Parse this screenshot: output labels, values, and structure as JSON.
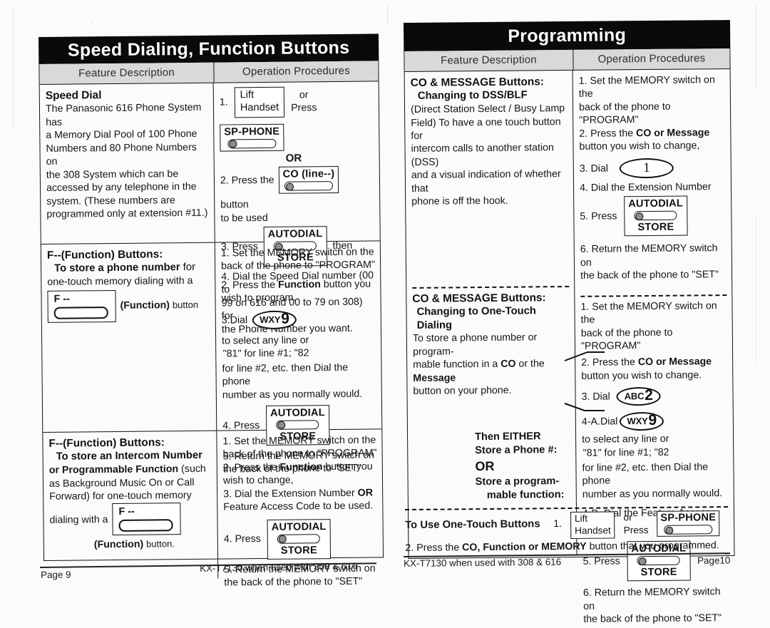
{
  "document": {
    "type": "scanned-manual-spread",
    "model_note": "KX-T7130 when used with 308 & 616"
  },
  "left_page": {
    "banner_title": "Speed Dialing, Function Buttons",
    "columns": {
      "feature": "Feature Description",
      "operation": "Operation Procedures"
    },
    "rows": [
      {
        "feature": {
          "title": "Speed Dial",
          "body": [
            "The Panasonic 616 Phone System has",
            "a Memory Dial Pool of 100 Phone",
            "Numbers and 80 Phone Numbers on",
            "the 308 System which can be",
            "accessed by any telephone in the",
            "system.  (These numbers are",
            "programmed only at extension #11.)"
          ]
        },
        "operation": {
          "step1_num": "1.",
          "step1_box1_line1": "Lift",
          "step1_box1_line2": "Handset",
          "step1_or": "or",
          "step1_press": "Press",
          "step1_sp_phone": "SP-PHONE",
          "step1_or_big": "OR",
          "step2_text": "2. Press the",
          "step2_button": "CO (line--)",
          "step2_after_line1": "button",
          "step2_after_line2": "to be used",
          "step3_text": "3. Press",
          "step3_button_top": "AUTODIAL",
          "step3_button_bottom": "STORE",
          "step3_after": "then",
          "step4_lines": [
            "4. Dial the Speed Dial number (00 to",
            "99 on 616 and 00 to 79 on 308) for",
            "the Phone Number you want."
          ]
        }
      },
      {
        "feature": {
          "title": "F--(Function) Buttons:",
          "subtitle_bold": "To store a phone number",
          "subtitle_rest": "for",
          "body_line": "one-touch memory dialing with a",
          "key_label": "F --",
          "after_key_bold": "(Function)",
          "after_key_rest": "button"
        },
        "operation": {
          "step1_lines": [
            "1. Set the MEMORY switch on the",
            "back of the phone to \"PROGRAM\""
          ],
          "step2_pre": "2. Press the",
          "step2_bold": "Function",
          "step2_post": "button you",
          "step2_line2": "wish to program.",
          "step3_pre": "3.Dial",
          "step3_key_small": "WXY",
          "step3_key_big": "9",
          "step3_post_line1": "to select any line or",
          "step3_post_line2": "\"81\" for line #1; \"82",
          "step3_cont": [
            "for line #2, etc. then Dial the phone",
            "number as you normally would."
          ],
          "step4_text": "4. Press",
          "step4_button_top": "AUTODIAL",
          "step4_button_bottom": "STORE",
          "step5_lines": [
            "5. Return the MEMORY switch on",
            "the back of the phone to \"SET\""
          ]
        }
      },
      {
        "feature": {
          "title": "F--(Function) Buttons:",
          "subtitle_bold": "To store an Intercom Number",
          "line2_bold": "or Programmable Function",
          "line2_rest": "(such",
          "body": [
            "as Background Music On or Call",
            "Forward) for one-touch memory"
          ],
          "body_last": "dialing with a",
          "key_label": "F --",
          "caption_bold": "(Function)",
          "caption_rest": "button."
        },
        "operation": {
          "step1_lines": [
            "1. Set the MEMORY switch on the",
            "back of the phone to \"PROGRAM\""
          ],
          "step2_pre": "2. Press the",
          "step2_bold": "Function",
          "step2_post": "button you",
          "step2_line2": "wish to change,",
          "step3_pre": "3. Dial the Extension Number",
          "step3_bold": "OR",
          "step3_line2": "Feature Access Code to be used.",
          "step4_text": "4. Press",
          "step4_button_top": "AUTODIAL",
          "step4_button_bottom": "STORE",
          "step5_lines": [
            "5. Return the MEMORY switch on",
            "the back of the phone to \"SET\""
          ]
        }
      }
    ],
    "footer": {
      "page_label": "Page 9",
      "model_note": "KX-T7130 when used with 308 & 616"
    }
  },
  "right_page": {
    "banner_title": "Programming",
    "columns": {
      "feature": "Feature Description",
      "operation": "Operation Procedures"
    },
    "sections": [
      {
        "feature": {
          "title": "CO & MESSAGE Buttons:",
          "subtitle": "Changing to DSS/BLF",
          "body": [
            "(Direct Station Select / Busy Lamp",
            "Field) To have a one touch button for",
            "intercom calls to another station (DSS)",
            "and a visual indication of whether that",
            "phone is off the hook."
          ]
        },
        "operation": {
          "step1_lines": [
            "1. Set the MEMORY switch on the",
            "back of the phone to \"PROGRAM\""
          ],
          "step2_pre": "2. Press the",
          "step2_bold": "CO or Message",
          "step2_line2": "button you wish to change,",
          "step3_text": "3. Dial",
          "step3_key": "1",
          "step4_text": "4. Dial the Extension Number",
          "step5_text": "5. Press",
          "step5_button_top": "AUTODIAL",
          "step5_button_bottom": "STORE",
          "step6_lines": [
            "6. Return the MEMORY switch on",
            "the back of the phone to \"SET\""
          ]
        }
      },
      {
        "feature": {
          "title": "CO & MESSAGE Buttons:",
          "subtitle": "Changing to One-Touch Dialing",
          "body_line1": "To store a phone number or program-",
          "body_line2_pre": "mable function in a",
          "body_line2_bold1": "CO",
          "body_line2_mid": "or the",
          "body_line2_bold2": "Message",
          "body_line3": "button on your phone.",
          "branch": {
            "either": "Then EITHER",
            "option_a": "Store a Phone #:",
            "or": "OR",
            "option_b_line1": "Store a program-",
            "option_b_line2": "mable function:"
          }
        },
        "operation": {
          "step1_lines": [
            "1. Set the MEMORY switch on the",
            "back of the phone to \"PROGRAM\""
          ],
          "step2_pre": "2. Press the",
          "step2_bold": "CO or Message",
          "step2_line2": "button you wish to change.",
          "step3_text": "3. Dial",
          "step3_key_small": "ABC",
          "step3_key_big": "2",
          "step4a_pre": "4-A.Dial",
          "step4a_key_small": "WXY",
          "step4a_key_big": "9",
          "step4a_post_line1": "to select any line or",
          "step4a_post_line2": "\"81\" for line #1; \"82",
          "step4a_cont": [
            "for line #2, etc. then Dial the phone",
            "number as you normally would."
          ],
          "step4b_text": "4-B. Dial the Feature Access Code",
          "step5_text": "5. Press",
          "step5_button_top": "AUTODIAL",
          "step5_button_bottom": "STORE",
          "step6_lines": [
            "6. Return the MEMORY switch on",
            "the back of the phone to \"SET\""
          ]
        }
      }
    ],
    "bottom_section": {
      "title": "To Use One-Touch Buttons",
      "step1_num": "1.",
      "step1_box_line1": "Lift",
      "step1_box_line2": "Handset",
      "step1_or": "or",
      "step1_press": "Press",
      "step1_sp_phone": "SP-PHONE",
      "step2_pre": "2. Press the",
      "step2_bold": "CO, Function or MEMORY",
      "step2_post": "button that you programmed."
    },
    "footer": {
      "page_label": "Page10",
      "model_note": "KX-T7130 when used with 308 & 616"
    }
  }
}
